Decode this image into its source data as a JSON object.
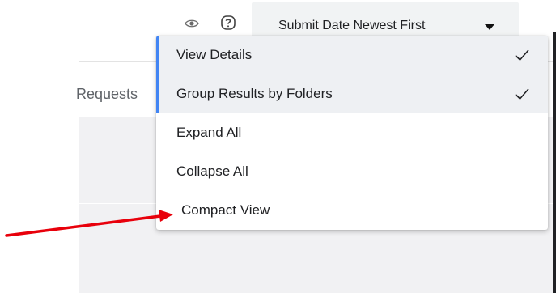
{
  "toolbar": {
    "view_icon": "eye-icon",
    "help_icon": "help-icon",
    "sort": {
      "label": "Submit Date Newest First",
      "caret_icon": "caret-down-icon"
    }
  },
  "tabs": {
    "requests_label": "Requests"
  },
  "menu": {
    "items": [
      {
        "label": "View Details",
        "checked": true
      },
      {
        "label": "Group Results by Folders",
        "checked": true
      },
      {
        "label": "Expand All",
        "checked": false
      },
      {
        "label": "Collapse All",
        "checked": false
      },
      {
        "label": "Compact View",
        "checked": false
      }
    ],
    "check_icon": "check-icon",
    "selected_accent": "#4285f4"
  },
  "annotation": {
    "arrow_color": "#e8000b",
    "arrow_target": "Compact View"
  }
}
